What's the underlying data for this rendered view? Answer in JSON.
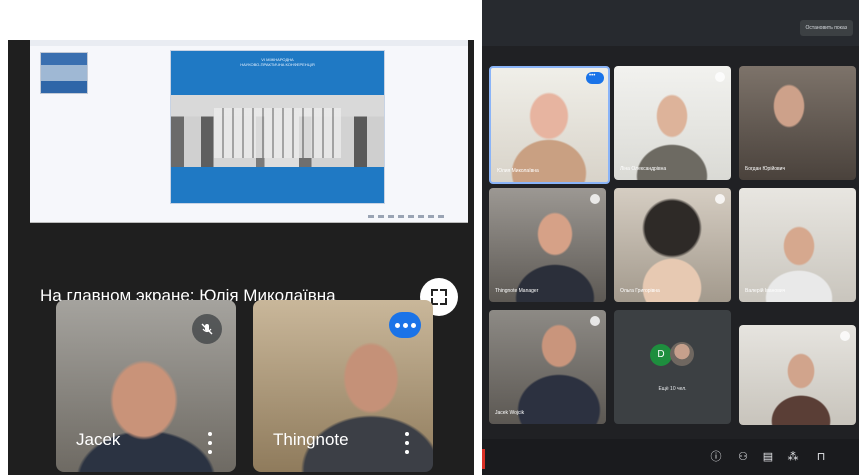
{
  "left": {
    "presenter_caption": "На главном экране: Юлія Миколаївна",
    "participants": [
      {
        "name": "Jacek"
      },
      {
        "name": "Thingnote"
      }
    ]
  },
  "right": {
    "stop_presenting": "Остановить показ",
    "tiles": [
      {
        "name": "Юлия Миколаївна"
      },
      {
        "name": "Ліна Олександрівна"
      },
      {
        "name": "Богдан Юрійович"
      },
      {
        "name": "Thingnote Manager"
      },
      {
        "name": "Ольга Григорівна"
      },
      {
        "name": "Валерій Іванович"
      },
      {
        "name": "Jacek Wojcik"
      },
      {
        "name": ""
      },
      {
        "name": ""
      }
    ],
    "others_tile": {
      "avatar_letter": "D",
      "label": "Ещё 10 чел."
    }
  },
  "slide": {
    "header_lines": [
      "VI МІЖНАРОДНА",
      "НАУКОВО-ПРАКТИЧНА КОНФЕРЕНЦІЯ",
      "",
      "",
      ""
    ],
    "date_line": ""
  },
  "icons": {
    "fullscreen": "fullscreen-icon",
    "mic_off": "mic-off-icon",
    "more": "more-vert-icon",
    "speaking": "speaking-indicator-icon"
  },
  "colors": {
    "speaking_blue": "#1a73e8",
    "panel_dark": "#202124",
    "leave_red": "#d93025"
  }
}
